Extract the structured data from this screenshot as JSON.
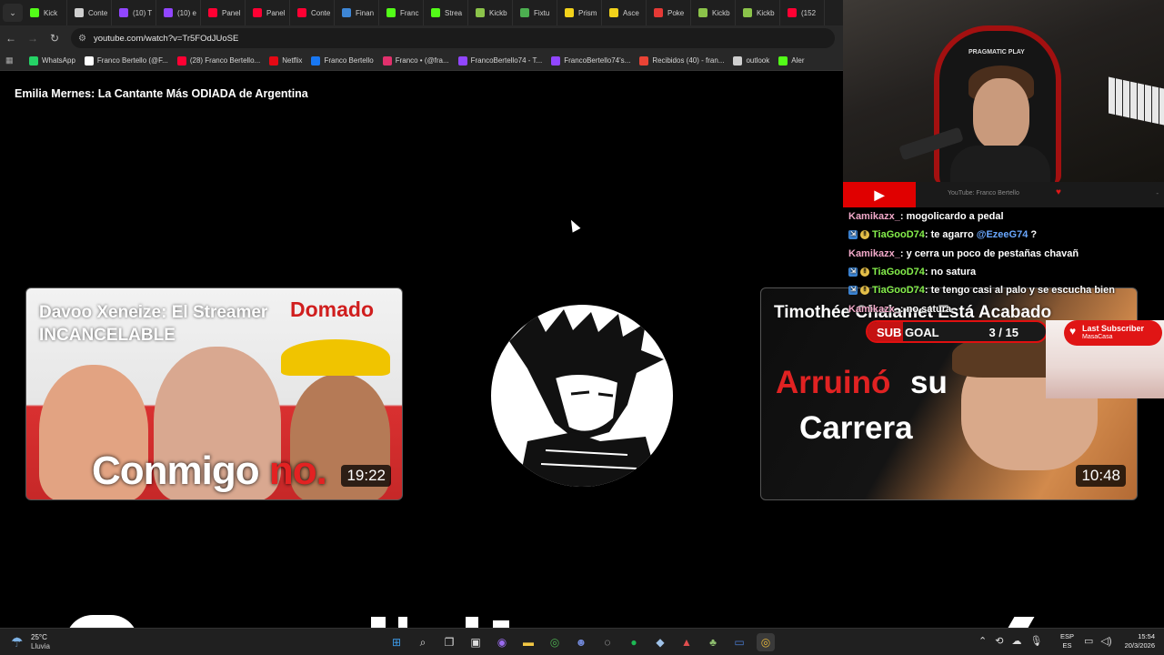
{
  "browser": {
    "tabs": [
      {
        "label": "Kick",
        "icon": "kick-icon",
        "color": "#53fc18"
      },
      {
        "label": "Conte",
        "icon": "globe-icon",
        "color": "#cfcfcf"
      },
      {
        "label": "(10) T",
        "icon": "twitch-icon",
        "color": "#9146ff"
      },
      {
        "label": "(10) e",
        "icon": "twitch-icon",
        "color": "#9146ff"
      },
      {
        "label": "Panel",
        "icon": "youtube-icon",
        "color": "#ff0033"
      },
      {
        "label": "Panel",
        "icon": "youtube-icon",
        "color": "#ff0033"
      },
      {
        "label": "Conte",
        "icon": "youtube-icon",
        "color": "#ff0033"
      },
      {
        "label": "Finan",
        "icon": "finance-icon",
        "color": "#3d86d6"
      },
      {
        "label": "Franc",
        "icon": "kick-icon",
        "color": "#53fc18"
      },
      {
        "label": "Strea",
        "icon": "kick-icon",
        "color": "#53fc18"
      },
      {
        "label": "Kickb",
        "icon": "kickbot-icon",
        "color": "#8bc34a"
      },
      {
        "label": "Fixtu",
        "icon": "fixture-icon",
        "color": "#4caf50"
      },
      {
        "label": "Prism",
        "icon": "prism-icon",
        "color": "#f2d21b"
      },
      {
        "label": "Asce",
        "icon": "ascent-icon",
        "color": "#f2d21b"
      },
      {
        "label": "Poke",
        "icon": "pokeball-icon",
        "color": "#e53935"
      },
      {
        "label": "Kickb",
        "icon": "kickbot-icon",
        "color": "#8bc34a"
      },
      {
        "label": "Kickb",
        "icon": "kickbot-icon",
        "color": "#8bc34a"
      },
      {
        "label": "(152",
        "icon": "youtube-icon",
        "color": "#ff0033"
      }
    ],
    "url": "youtube.com/watch?v=Tr5FOdJUoSE",
    "bookmarks": [
      {
        "label": "WhatsApp",
        "icon": "whatsapp-icon",
        "color": "#25d366"
      },
      {
        "label": "Franco Bertello (@F...",
        "icon": "x-icon",
        "color": "#ffffff"
      },
      {
        "label": "(28) Franco Bertello...",
        "icon": "youtube-icon",
        "color": "#ff0033"
      },
      {
        "label": "Netflix",
        "icon": "netflix-icon",
        "color": "#e50914"
      },
      {
        "label": "Franco Bertello",
        "icon": "facebook-icon",
        "color": "#1877f2"
      },
      {
        "label": "Franco • (@fra...",
        "icon": "instagram-icon",
        "color": "#e1306c"
      },
      {
        "label": "FrancoBertello74 - T...",
        "icon": "twitch-icon",
        "color": "#9146ff"
      },
      {
        "label": "FrancoBertello74's...",
        "icon": "twitch-icon",
        "color": "#9146ff"
      },
      {
        "label": "Recibidos (40) - fran...",
        "icon": "gmail-icon",
        "color": "#ea4335"
      },
      {
        "label": "outlook",
        "icon": "globe-icon",
        "color": "#cfcfcf"
      },
      {
        "label": "Aler",
        "icon": "alert-icon",
        "color": "#53fc18"
      }
    ]
  },
  "page": {
    "title": "Emilia Mernes: La Cantante Más ODIADA de Argentina"
  },
  "cards": {
    "left": {
      "title": "Davoo Xeneize: El Streamer INCANCELABLE",
      "overlay": "Domado",
      "big_word": "Conmigo",
      "big_word_red": "no.",
      "duration": "19:22"
    },
    "right": {
      "title": "Timothée Chalamet Está Acabado",
      "red_word": "Arruinó",
      "white_word1": "su",
      "white_word2": "Carrera",
      "duration": "10:48"
    }
  },
  "stream": {
    "chair_brand": "PRAGMATIC PLAY",
    "youtube_bar_text": "YouTube: Franco Bertello",
    "chat": [
      {
        "user": "Kamikazx_",
        "message": ": mogolicardo a pedal",
        "color": "pink",
        "badges": false
      },
      {
        "user": "TiaGooD74",
        "message": ": te agarro ",
        "mention": "@EzeeG74",
        "tail": " ?",
        "color": "green",
        "badges": true
      },
      {
        "user": "Kamikazx_",
        "message": ": y cerra un poco de pestañas chavañ",
        "color": "pink",
        "badges": false
      },
      {
        "user": "TiaGooD74",
        "message": ": no satura",
        "color": "green",
        "badges": true
      },
      {
        "user": "TiaGooD74",
        "message": ": te tengo casi al palo y se escucha bien",
        "color": "green",
        "badges": true
      },
      {
        "user": "Kamikazx_",
        "message": ": no satura",
        "color": "pink",
        "badges": false
      }
    ],
    "subgoal": {
      "label": "SUB GOAL",
      "current": 3,
      "target": 15,
      "text": "3 / 15"
    },
    "last_subscriber": {
      "title": "Last Subscriber",
      "name": "MasaCasa"
    }
  },
  "taskbar": {
    "weather_temp": "25°C",
    "weather_desc": "Lluvia",
    "lang_top": "ESP",
    "lang_bottom": "ES",
    "time": "15:54",
    "date": "20/3/2026",
    "apps": [
      "windows-start-icon",
      "search-icon",
      "task-view-icon",
      "widgets-icon",
      "app-circle-icon",
      "file-explorer-icon",
      "chrome-icon",
      "discord-icon",
      "obs-icon",
      "spotify-icon",
      "steam-icon",
      "gpu-icon",
      "app-icon",
      "window-icon",
      "chrome-active-icon"
    ]
  },
  "colors": {
    "accent_red": "#e01010",
    "chat_green": "#86f04c",
    "chat_pink": "#f0a8c8",
    "mention_blue": "#6aa8ff"
  }
}
